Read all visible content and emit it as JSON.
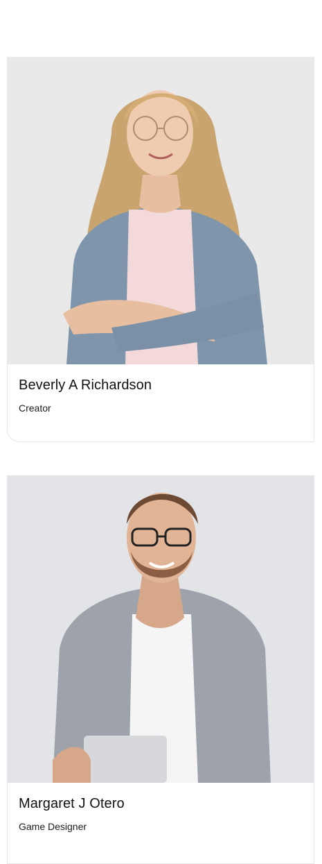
{
  "team": {
    "members": [
      {
        "name": "Beverly A Richardson",
        "role": "Creator"
      },
      {
        "name": "Margaret J Otero",
        "role": "Game Designer"
      }
    ]
  },
  "colors": {
    "card_border": "#e6e6e6",
    "photo_bg_1": "#e9e9ea",
    "photo_bg_2": "#e2e4e7"
  }
}
